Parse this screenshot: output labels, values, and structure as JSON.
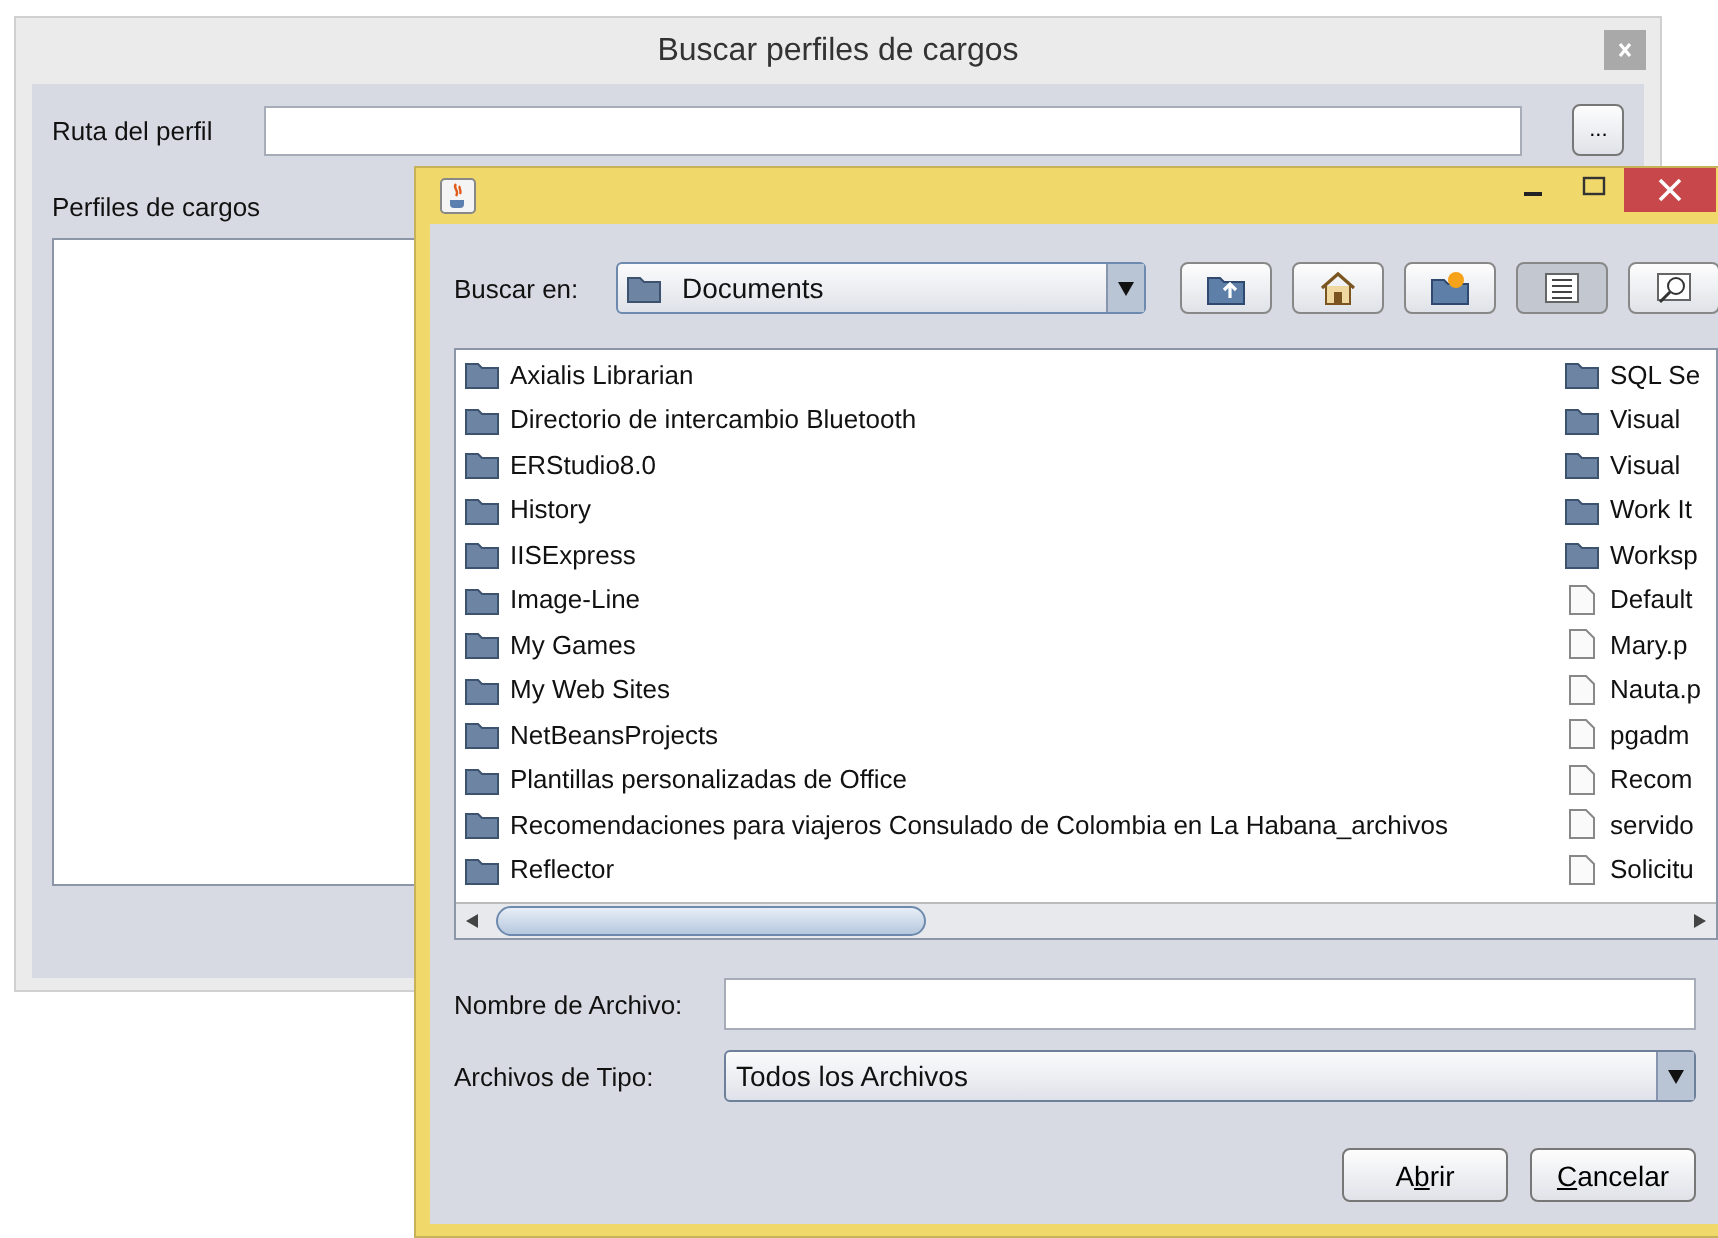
{
  "main_window": {
    "title": "Buscar perfiles de cargos",
    "path_label": "Ruta del perfil",
    "browse_button": "...",
    "profiles_label": "Perfiles de cargos"
  },
  "dialog": {
    "look_in_label": "Buscar en:",
    "look_in_value": "Documents",
    "files": [
      {
        "name": "Axialis Librarian",
        "kind": "folder"
      },
      {
        "name": "Directorio de intercambio Bluetooth",
        "kind": "folder"
      },
      {
        "name": "ERStudio8.0",
        "kind": "folder"
      },
      {
        "name": "History",
        "kind": "folder"
      },
      {
        "name": "IISExpress",
        "kind": "folder"
      },
      {
        "name": "Image-Line",
        "kind": "folder"
      },
      {
        "name": "My Games",
        "kind": "folder"
      },
      {
        "name": "My Web Sites",
        "kind": "folder"
      },
      {
        "name": "NetBeansProjects",
        "kind": "folder"
      },
      {
        "name": "Plantillas personalizadas de Office",
        "kind": "folder"
      },
      {
        "name": "Recomendaciones para viajeros  Consulado de Colombia en La Habana_archivos",
        "kind": "folder"
      },
      {
        "name": "Reflector",
        "kind": "folder"
      },
      {
        "name": "SQL Se",
        "kind": "folder"
      },
      {
        "name": "Visual",
        "kind": "folder"
      },
      {
        "name": "Visual",
        "kind": "folder"
      },
      {
        "name": "Work It",
        "kind": "folder"
      },
      {
        "name": "Worksp",
        "kind": "folder"
      },
      {
        "name": "Default",
        "kind": "file"
      },
      {
        "name": "Mary.p",
        "kind": "file"
      },
      {
        "name": "Nauta.p",
        "kind": "file"
      },
      {
        "name": "pgadm",
        "kind": "file"
      },
      {
        "name": "Recom",
        "kind": "file"
      },
      {
        "name": "servido",
        "kind": "file"
      },
      {
        "name": "Solicitu",
        "kind": "file"
      }
    ],
    "filename_label": "Nombre de Archivo:",
    "filetype_label": "Archivos de Tipo:",
    "filetype_value": "Todos los Archivos",
    "buttons": [
      {
        "before": "A",
        "mnemonic": "b",
        "after": "rir"
      },
      {
        "mnemonic": "C",
        "after": "ancelar"
      }
    ]
  }
}
